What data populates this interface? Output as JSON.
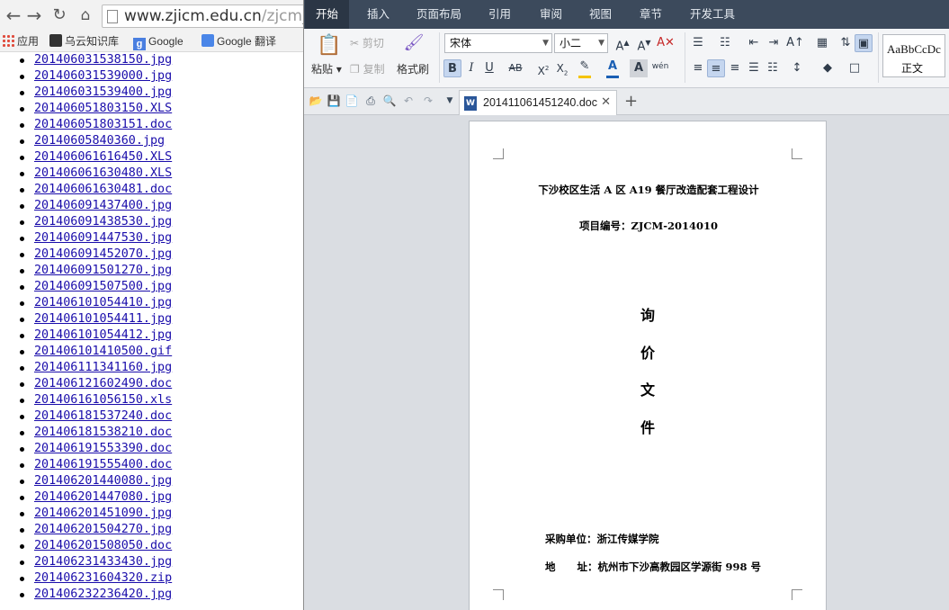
{
  "browser": {
    "url_host": "www.zjicm.edu.cn",
    "url_path": "/zjcm_fi",
    "bookmarks": {
      "apps": "应用",
      "wuyun": "乌云知识库",
      "google": "Google",
      "translate": "Google 翻译"
    },
    "files": [
      "201406031538150.jpg",
      "201406031539000.jpg",
      "201406031539400.jpg",
      "201406051803150.XLS",
      "201406051803151.doc",
      "20140605840360.jpg",
      "201406061616450.XLS",
      "201406061630480.XLS",
      "201406061630481.doc",
      "201406091437400.jpg",
      "201406091438530.jpg",
      "201406091447530.jpg",
      "201406091452070.jpg",
      "201406091501270.jpg",
      "201406091507500.jpg",
      "201406101054410.jpg",
      "201406101054411.jpg",
      "201406101054412.jpg",
      "201406101410500.gif",
      "201406111341160.jpg",
      "201406121602490.doc",
      "201406161056150.xls",
      "201406181537240.doc",
      "201406181538210.doc",
      "201406191553390.doc",
      "201406191555400.doc",
      "201406201440080.jpg",
      "201406201447080.jpg",
      "201406201451090.jpg",
      "201406201504270.jpg",
      "201406201508050.doc",
      "201406231433430.jpg",
      "201406231604320.zip",
      "201406232236420.jpg"
    ]
  },
  "wps": {
    "menu_tabs": [
      "开始",
      "插入",
      "页面布局",
      "引用",
      "审阅",
      "视图",
      "章节",
      "开发工具"
    ],
    "ribbon": {
      "paste": "粘贴",
      "cut": "剪切",
      "copy": "复制",
      "format_painter": "格式刷",
      "font_name": "宋体",
      "font_size": "小二",
      "style_sample": "AaBbCcDc",
      "style_name": "正文"
    },
    "document_tab_title": "201411061451240.doc",
    "document": {
      "title": "下沙校区生活 A 区 A19 餐厅改造配套工程设计",
      "project_number": "项目编号：ZJCM-2014010",
      "big_chars": [
        "询",
        "价",
        "文",
        "件"
      ],
      "purchaser": "采购单位：浙江传媒学院",
      "address": "地      址：杭州市下沙高教园区学源街 998 号"
    },
    "colors": {
      "menubar": "#3c4a5c",
      "link": "#1a0dab",
      "font_color_swatch": "#1a5fb4",
      "highlight_swatch": "#f5c400"
    }
  }
}
